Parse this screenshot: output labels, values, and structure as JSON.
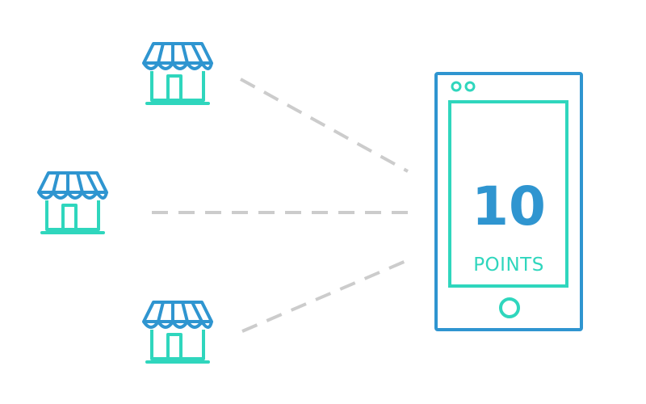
{
  "phone": {
    "points_value": "10",
    "points_label": "POINTS"
  },
  "stores": [
    {
      "icon": "storefront-icon"
    },
    {
      "icon": "storefront-icon"
    },
    {
      "icon": "storefront-icon"
    }
  ],
  "colors": {
    "blue": "#2f95d0",
    "teal": "#2fd6bd",
    "connector": "#cccccc",
    "background": "#ffffff"
  }
}
